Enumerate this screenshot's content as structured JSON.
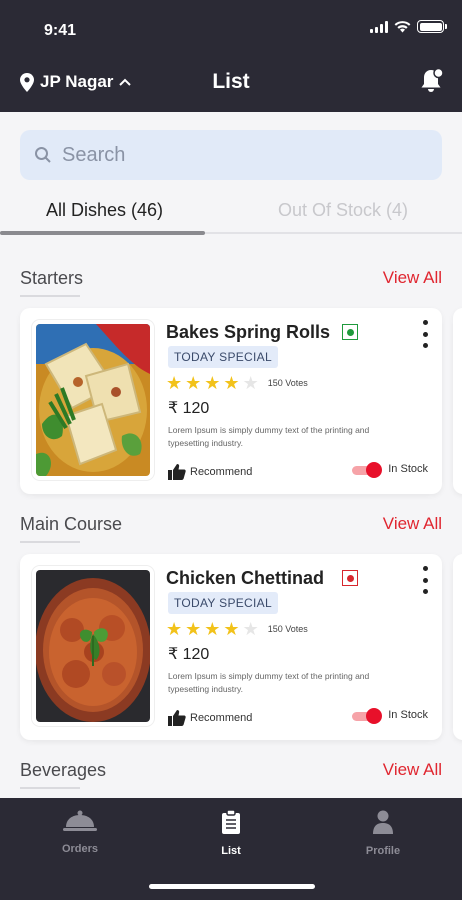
{
  "status": {
    "time": "9:41"
  },
  "header": {
    "location": "JP Nagar",
    "title": "List"
  },
  "search": {
    "placeholder": "Search"
  },
  "tabs": [
    {
      "label": "All Dishes (46)",
      "active": true
    },
    {
      "label": "Out Of Stock (4)",
      "active": false
    }
  ],
  "sections": [
    {
      "title": "Starters",
      "view_all": "View All"
    },
    {
      "title": "Main Course",
      "view_all": "View All"
    },
    {
      "title": "Beverages",
      "view_all": "View All"
    }
  ],
  "dishes": [
    {
      "name": "Bakes Spring Rolls",
      "veg": true,
      "badge": "TODAY SPECIAL",
      "rating": 4,
      "max_rating": 5,
      "votes": "150 Votes",
      "price": "₹ 120",
      "description": "Lorem Ipsum is simply dummy text of the printing and typesetting industry.",
      "recommend": "Recommend",
      "stock_label": "In Stock",
      "in_stock": true
    },
    {
      "name": "Chicken Chettinad",
      "veg": false,
      "badge": "TODAY SPECIAL",
      "rating": 4,
      "max_rating": 5,
      "votes": "150 Votes",
      "price": "₹ 120",
      "description": "Lorem Ipsum is simply dummy text of the printing and typesetting industry.",
      "recommend": "Recommend",
      "stock_label": "In Stock",
      "in_stock": true
    }
  ],
  "nav": [
    {
      "label": "Orders",
      "icon": "cloche-icon",
      "active": false
    },
    {
      "label": "List",
      "icon": "clipboard-icon",
      "active": true
    },
    {
      "label": "Profile",
      "icon": "person-icon",
      "active": false
    }
  ],
  "colors": {
    "header_bg": "#2b2a35",
    "accent_red": "#e02630",
    "search_bg": "#e1eaf8",
    "star": "#f2c21a",
    "veg_green": "#1f9a3c",
    "nonveg_red": "#d7262d"
  }
}
